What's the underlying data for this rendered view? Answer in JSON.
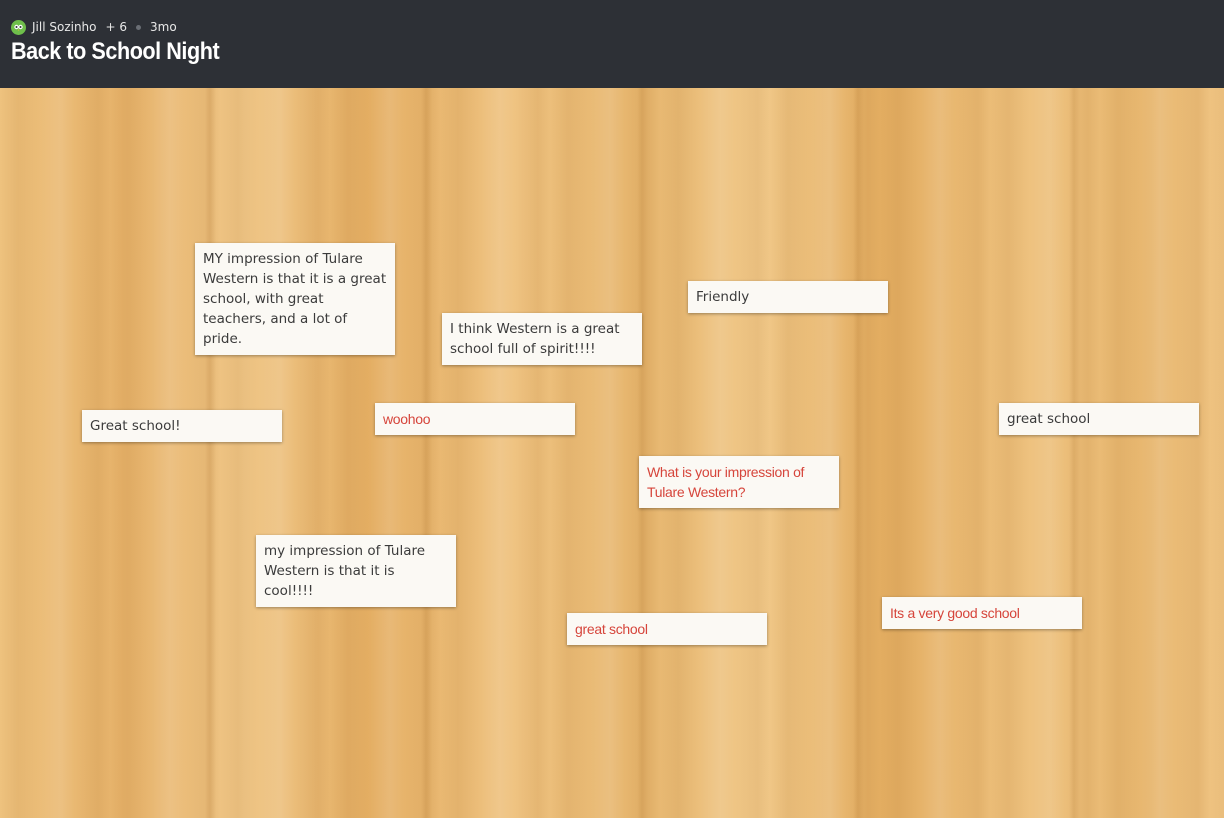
{
  "header": {
    "author": "Jill Sozinho",
    "collaborators": "+ 6",
    "age": "3mo",
    "title": "Back to School Night"
  },
  "notes": [
    {
      "text": "MY impression of Tulare Western is that it is a great school, with great teachers, and a lot of pride."
    },
    {
      "text": "Friendly"
    },
    {
      "text": "I think Western is a great school full of spirit!!!!"
    },
    {
      "text": "Great school!"
    },
    {
      "text": "woohoo"
    },
    {
      "text": "great school"
    },
    {
      "text": "What is your impression of Tulare Western?"
    },
    {
      "text": "my impression of  Tulare Western is that it is cool!!!!"
    },
    {
      "text": "great school"
    },
    {
      "text": "Its a very good school"
    }
  ],
  "colors": {
    "header_bg": "#2d3036",
    "accent_red": "#d6453b",
    "note_bg": "#fbf9f4"
  }
}
